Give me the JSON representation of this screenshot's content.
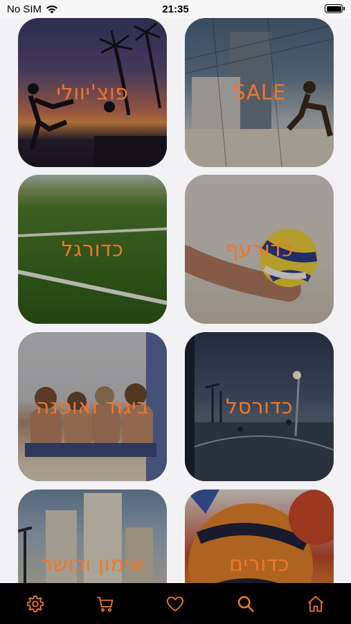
{
  "status_bar": {
    "carrier": "No SIM",
    "time": "21:35",
    "battery_level": 1.0
  },
  "categories": [
    {
      "key": "foot-volley",
      "label": "פוצ'יוולי"
    },
    {
      "key": "sale",
      "label": "SALE"
    },
    {
      "key": "football",
      "label": "כדורגל"
    },
    {
      "key": "volleyball",
      "label": "כדורעף"
    },
    {
      "key": "clothing-fashion",
      "label": "ביגוד ואופנה"
    },
    {
      "key": "basketball",
      "label": "כדורסל"
    },
    {
      "key": "training-fitness",
      "label": "אימון וכושר"
    },
    {
      "key": "balls",
      "label": "כדורים"
    }
  ],
  "tab_bar": {
    "items": [
      {
        "icon": "gear-icon"
      },
      {
        "icon": "cart-icon"
      },
      {
        "icon": "heart-icon"
      },
      {
        "icon": "search-icon"
      },
      {
        "icon": "home-icon"
      }
    ]
  },
  "colors": {
    "accent": "#f0752b",
    "tab_bar_background": "#000000",
    "page_background": "#f2f2f4"
  }
}
